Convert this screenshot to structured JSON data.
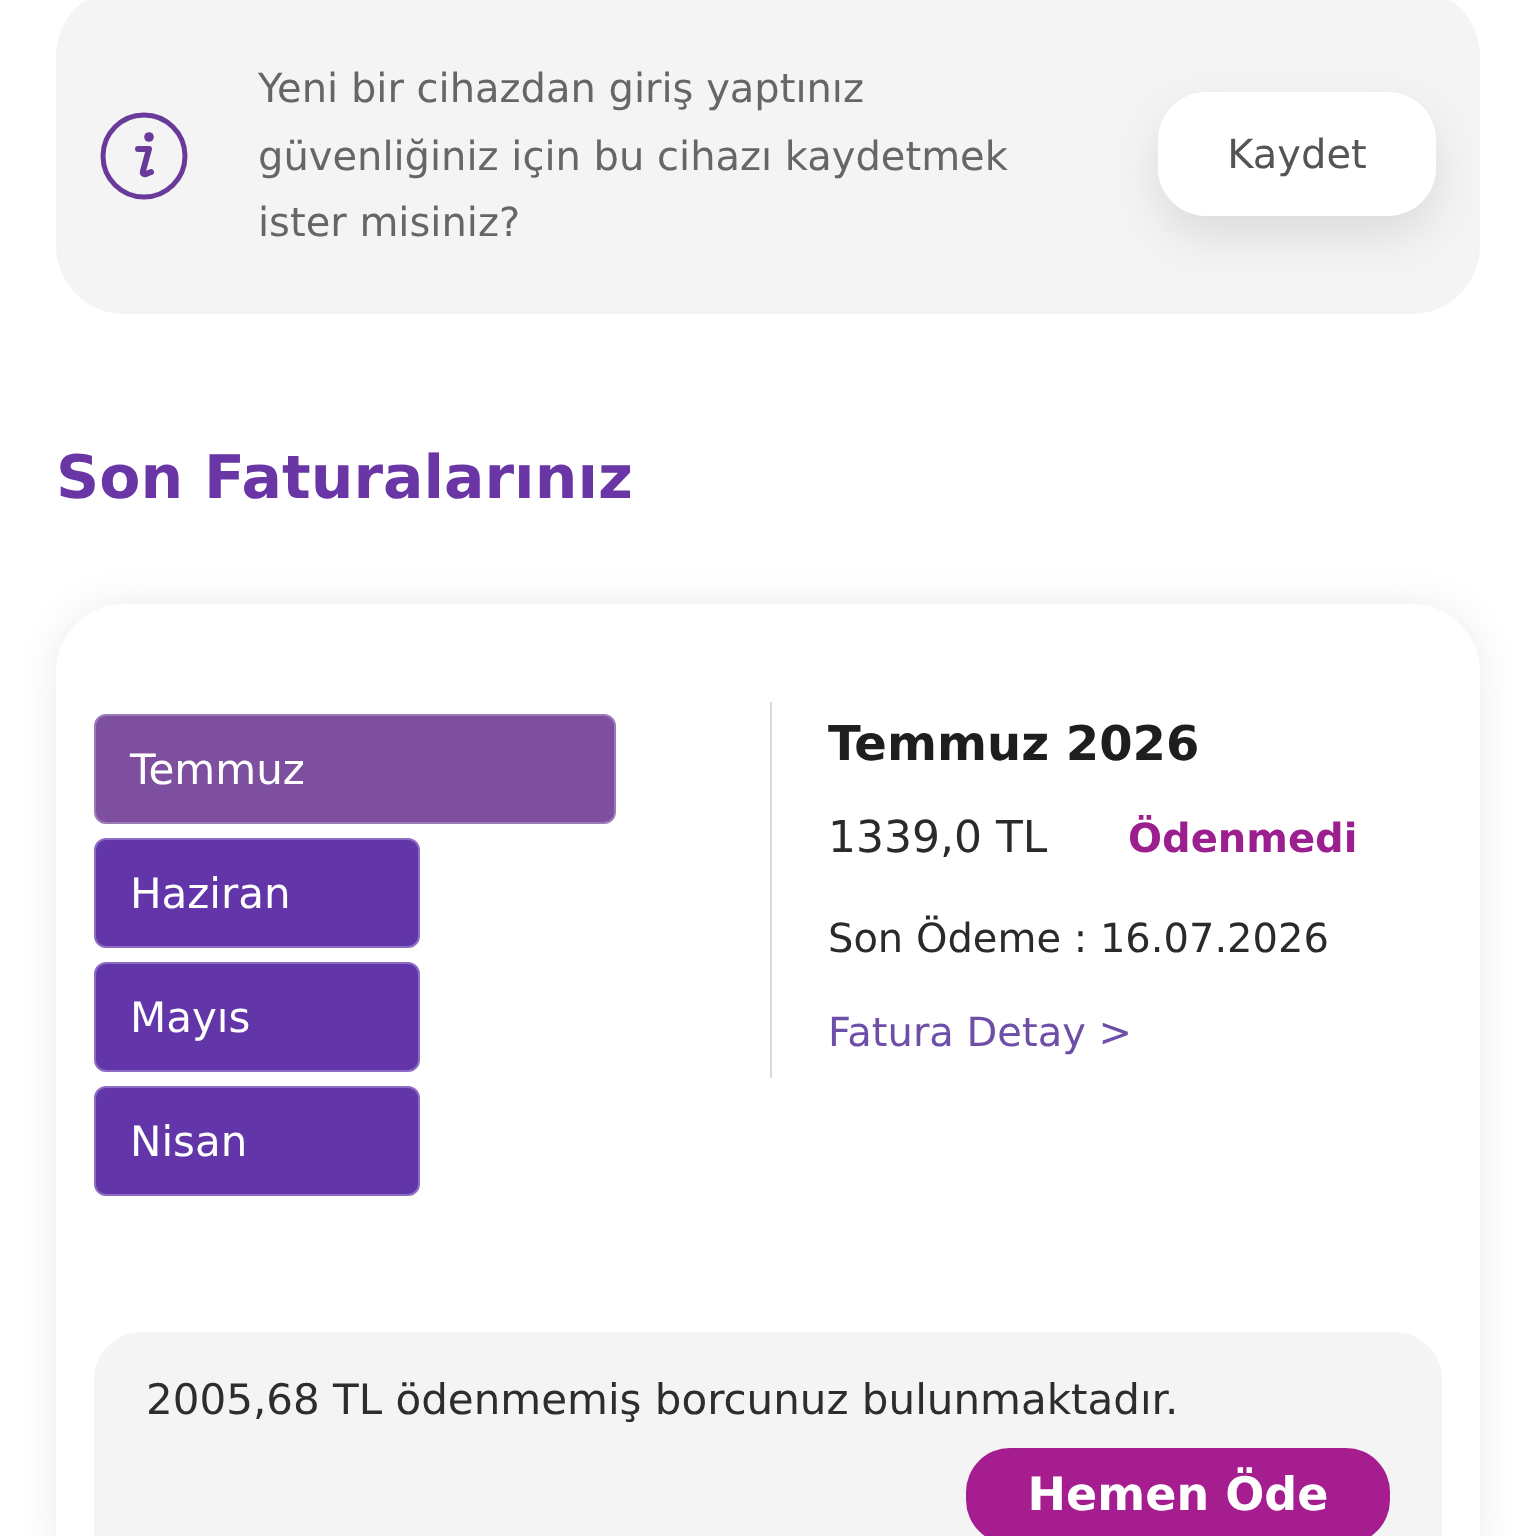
{
  "notice": {
    "message": "Yeni bir cihazdan giriş yaptınız güvenliğiniz için bu cihazı kaydetmek ister misiniz?",
    "button": "Kaydet"
  },
  "section_title": "Son Faturalarınız",
  "months": [
    {
      "label": "Temmuz",
      "selected": true
    },
    {
      "label": "Haziran",
      "selected": false
    },
    {
      "label": "Mayıs",
      "selected": false
    },
    {
      "label": "Nisan",
      "selected": false
    }
  ],
  "invoice": {
    "title": "Temmuz 2026",
    "amount": "1339,0 TL",
    "status": "Ödenmedi",
    "paid": false,
    "due_date": "Son Ödeme : 16.07.2026",
    "detail_link": "Fatura Detay >"
  },
  "debt": {
    "message": "2005,68 TL ödenmemiş borcunuz bulunmaktadır.",
    "button": "Hemen Öde"
  }
}
